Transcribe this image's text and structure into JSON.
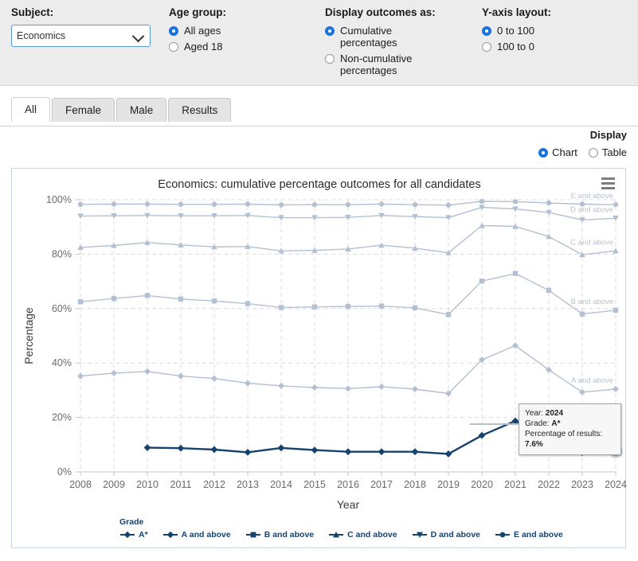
{
  "controls": {
    "subject": {
      "label": "Subject:",
      "value": "Economics",
      "options": [
        "Economics"
      ],
      "caret_icon": "chevron-down-icon"
    },
    "age_group": {
      "label": "Age group:",
      "options": [
        {
          "label": "All ages",
          "selected": true
        },
        {
          "label": "Aged 18",
          "selected": false
        }
      ]
    },
    "display_outcomes": {
      "label": "Display outcomes as:",
      "options": [
        {
          "label": "Cumulative percentages",
          "selected": true
        },
        {
          "label": "Non-cumulative percentages",
          "selected": false
        }
      ]
    },
    "yaxis_layout": {
      "label": "Y-axis layout:",
      "options": [
        {
          "label": "0 to 100",
          "selected": true
        },
        {
          "label": "100 to 0",
          "selected": false
        }
      ]
    }
  },
  "tabs": [
    {
      "label": "All",
      "active": true
    },
    {
      "label": "Female",
      "active": false
    },
    {
      "label": "Male",
      "active": false
    },
    {
      "label": "Results",
      "active": false
    }
  ],
  "display": {
    "title": "Display",
    "options": [
      {
        "label": "Chart",
        "selected": true
      },
      {
        "label": "Table",
        "selected": false
      }
    ]
  },
  "chart_menu_icon": "hamburger-menu-icon",
  "tooltip": {
    "year_label": "Year:",
    "year_value": "2024",
    "grade_label": "Grade:",
    "grade_value": "A*",
    "pct_label": "Percentage of results:",
    "pct_value": "7.6%"
  },
  "legend": {
    "title": "Grade",
    "items": [
      {
        "label": "A*",
        "marker": "diamond",
        "color": "#16436e"
      },
      {
        "label": "A and above",
        "marker": "diamond",
        "color": "#16436e"
      },
      {
        "label": "B and above",
        "marker": "square",
        "color": "#16436e"
      },
      {
        "label": "C and above",
        "marker": "triangle",
        "color": "#16436e"
      },
      {
        "label": "D and above",
        "marker": "triangle-down",
        "color": "#16436e"
      },
      {
        "label": "E and above",
        "marker": "circle",
        "color": "#16436e"
      }
    ]
  },
  "colors": {
    "accent": "#1b74e4",
    "series_dark": "#16436e",
    "series_light": "#b3c0d1",
    "panel_border": "#c9d4e0",
    "grid": "#dcdcdc",
    "controls_bg": "#ececec"
  },
  "chart_data": {
    "type": "line",
    "title": "Economics: cumulative percentage outcomes for all candidates",
    "xlabel": "Year",
    "ylabel": "Percentage",
    "ylim": [
      0,
      100
    ],
    "ytick_labels": [
      "0%",
      "20%",
      "40%",
      "60%",
      "80%",
      "100%"
    ],
    "yticks": [
      0,
      20,
      40,
      60,
      80,
      100
    ],
    "grid": true,
    "legend_position": "bottom",
    "categories": [
      2008,
      2009,
      2010,
      2011,
      2012,
      2013,
      2014,
      2015,
      2016,
      2017,
      2018,
      2019,
      2020,
      2021,
      2022,
      2023,
      2024
    ],
    "series": [
      {
        "name": "E and above",
        "marker": "circle",
        "color": "#b3c0d1",
        "values": [
          98.3,
          98.4,
          98.4,
          98.3,
          98.3,
          98.4,
          98.1,
          98.2,
          98.2,
          98.4,
          98.2,
          98.0,
          99.4,
          99.3,
          98.8,
          98.4,
          98.2
        ]
      },
      {
        "name": "D and above",
        "marker": "triangle-down",
        "color": "#b3c0d1",
        "values": [
          94.0,
          94.1,
          94.2,
          94.1,
          94.1,
          94.2,
          93.4,
          93.4,
          93.5,
          94.2,
          93.8,
          93.4,
          97.2,
          96.6,
          95.3,
          92.6,
          93.2
        ]
      },
      {
        "name": "C and above",
        "marker": "triangle",
        "color": "#b3c0d1",
        "values": [
          82.5,
          83.2,
          84.3,
          83.4,
          82.7,
          82.8,
          81.2,
          81.4,
          81.9,
          83.3,
          82.2,
          80.5,
          90.5,
          90.2,
          86.5,
          79.8,
          81.2
        ]
      },
      {
        "name": "B and above",
        "marker": "square",
        "color": "#b3c0d1",
        "values": [
          62.5,
          63.7,
          64.8,
          63.5,
          62.8,
          61.8,
          60.4,
          60.6,
          60.8,
          60.9,
          60.3,
          57.8,
          70.1,
          72.9,
          66.7,
          58.0,
          59.4
        ]
      },
      {
        "name": "A and above",
        "marker": "diamond",
        "color": "#b3c0d1",
        "values": [
          35.2,
          36.3,
          36.9,
          35.2,
          34.3,
          32.6,
          31.6,
          31.0,
          30.6,
          31.3,
          30.4,
          28.8,
          41.2,
          46.4,
          37.5,
          29.3,
          30.4
        ]
      },
      {
        "name": "A*",
        "marker": "diamond",
        "color": "#16436e",
        "values": [
          null,
          null,
          8.9,
          8.7,
          8.2,
          7.2,
          8.8,
          8.0,
          7.4,
          7.4,
          7.4,
          6.6,
          13.4,
          18.7,
          11.7,
          7.1,
          7.6
        ]
      }
    ],
    "highlight_point": {
      "series": "A*",
      "year": 2024,
      "value": 7.6,
      "label": "A*"
    }
  }
}
